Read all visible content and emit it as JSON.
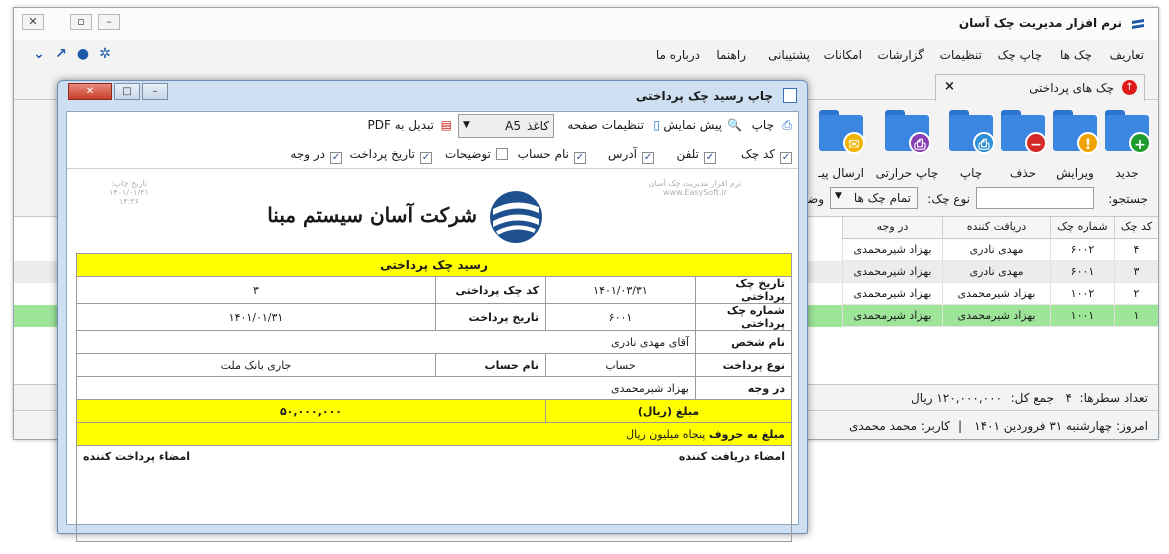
{
  "app": {
    "title": "نرم افزار مدیریت چک آسان",
    "menu": [
      "تعاریف",
      "چک ها",
      "چاپ چک",
      "تنظیمات",
      "گزارشات",
      "امکانات",
      "پشتیبانی",
      "راهنما",
      "درباره ما"
    ],
    "tab_label": "چک های پرداختی",
    "ribbon": [
      {
        "label": "جدید",
        "badge": "+",
        "color": "#1f9a2e"
      },
      {
        "label": "ویرایش",
        "badge": "!",
        "color": "#f0a300"
      },
      {
        "label": "حذف",
        "badge": "−",
        "color": "#d42a2a"
      },
      {
        "label": "چاپ",
        "badge": "⎙",
        "color": "#2e8fd6"
      },
      {
        "label": "چاپ حرارتی",
        "badge": "⎙",
        "color": "#8a3fb5"
      },
      {
        "label": "ارسال پیـ",
        "badge": "✉",
        "color": "#f0b400"
      }
    ],
    "search": {
      "label": "جستجو:",
      "type_label": "نوع چک:",
      "type_value": "تمام چک ها",
      "status_label": "وضعیت:"
    },
    "grid": {
      "headers": [
        "کد چک",
        "شماره چک",
        "دریافت کننده",
        "در وجه"
      ],
      "rows": [
        {
          "code": "۴",
          "number": "۶۰۰۲",
          "receiver": "مهدی نادری",
          "payee": "بهزاد شیرمحمدی"
        },
        {
          "code": "۳",
          "number": "۶۰۰۱",
          "receiver": "مهدی نادری",
          "payee": "بهزاد شیرمحمدی"
        },
        {
          "code": "۲",
          "number": "۱۰۰۲",
          "receiver": "بهزاد شیرمحمدی",
          "payee": "بهزاد شیرمحمدی"
        },
        {
          "code": "۱",
          "number": "۱۰۰۱",
          "receiver": "بهزاد شیرمحمدی",
          "payee": "بهزاد شیرمحمدی"
        }
      ]
    },
    "status": {
      "rows_label": "تعداد سطرها:",
      "rows_value": "۴",
      "sum_label": "جمع کل:",
      "sum_value": "۱۲۰,۰۰۰,۰۰۰ ریال",
      "today": "امروز: چهارشنبه ۳۱ فروردین ۱۴۰۱",
      "user": "کاربر: محمد محمدی"
    }
  },
  "dialog": {
    "title": "چاپ رسید چک پرداختی",
    "toolbar": {
      "print": "چاپ",
      "preview": "پیش نمایش",
      "page_setup": "تنظیمات صفحه",
      "paper_label": "کاغذ",
      "paper_value": "A5",
      "pdf": "تبدیل به PDF"
    },
    "checks": [
      {
        "label": "کد چک",
        "checked": true
      },
      {
        "label": "تلفن",
        "checked": true
      },
      {
        "label": "آدرس",
        "checked": true
      },
      {
        "label": "نام حساب",
        "checked": true
      },
      {
        "label": "توضیحات",
        "checked": false
      },
      {
        "label": "تاریخ پرداخت",
        "checked": true
      },
      {
        "label": "در وجه",
        "checked": true
      }
    ],
    "receipt": {
      "company": "شرکت آسان سیستم مبنا",
      "watermark1": "نرم افزار مدیریت چک آسان",
      "watermark2": "www.EasySoft.ir",
      "print_date_label": "تاریخ چاپ:",
      "print_date": "۱۴۰۱/۰۱/۳۱",
      "print_time": "۱۳:۳۶",
      "heading": "رسید چک پرداختی",
      "check_date_label": "تاریخ چک پرداختی",
      "check_date": "۱۴۰۱/۰۳/۳۱",
      "check_code_label": "کد چک پرداختی",
      "check_code": "۳",
      "check_number_label": "شماره چک پرداختی",
      "check_number": "۶۰۰۱",
      "pay_date_label": "تاریخ پرداخت",
      "pay_date": "۱۴۰۱/۰۱/۳۱",
      "person_label": "نام شخص",
      "person": "آقای مهدی نادری",
      "pay_type_label": "نوع پرداخت",
      "pay_type": "حساب",
      "account_label": "نام حساب",
      "account": "جاری بانک ملت",
      "payee_label": "در وجه",
      "payee": "بهزاد شیرمحمدی",
      "amount_label": "مبلغ (ریال)",
      "amount": "۵۰,۰۰۰,۰۰۰",
      "amount_words_label": "مبلغ به حروف",
      "amount_words": "پنجاه میلیون ریال",
      "sign_receiver": "امضاء دریافت کننده",
      "sign_payer": "امضاء پرداخت کننده"
    }
  }
}
